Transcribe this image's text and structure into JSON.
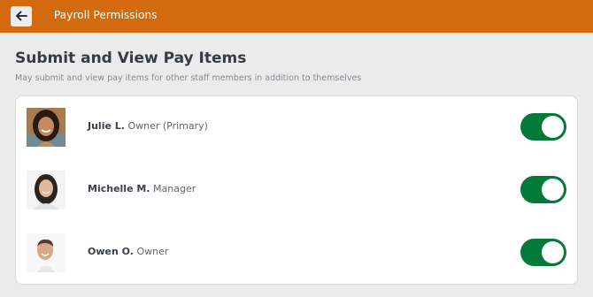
{
  "header": {
    "title": "Payroll Permissions",
    "back_icon": "arrow-left-icon"
  },
  "section": {
    "title": "Submit and View Pay Items",
    "subtitle": "May submit and view pay items for other staff members in addition to themselves"
  },
  "staff": [
    {
      "name": "Julie L.",
      "role": "Owner (Primary)",
      "enabled": true
    },
    {
      "name": "Michelle M.",
      "role": "Manager",
      "enabled": true
    },
    {
      "name": "Owen O.",
      "role": "Owner",
      "enabled": true
    }
  ],
  "colors": {
    "header_bg": "#d36a0f",
    "toggle_on": "#047a3a",
    "page_bg": "#e9eceb"
  }
}
